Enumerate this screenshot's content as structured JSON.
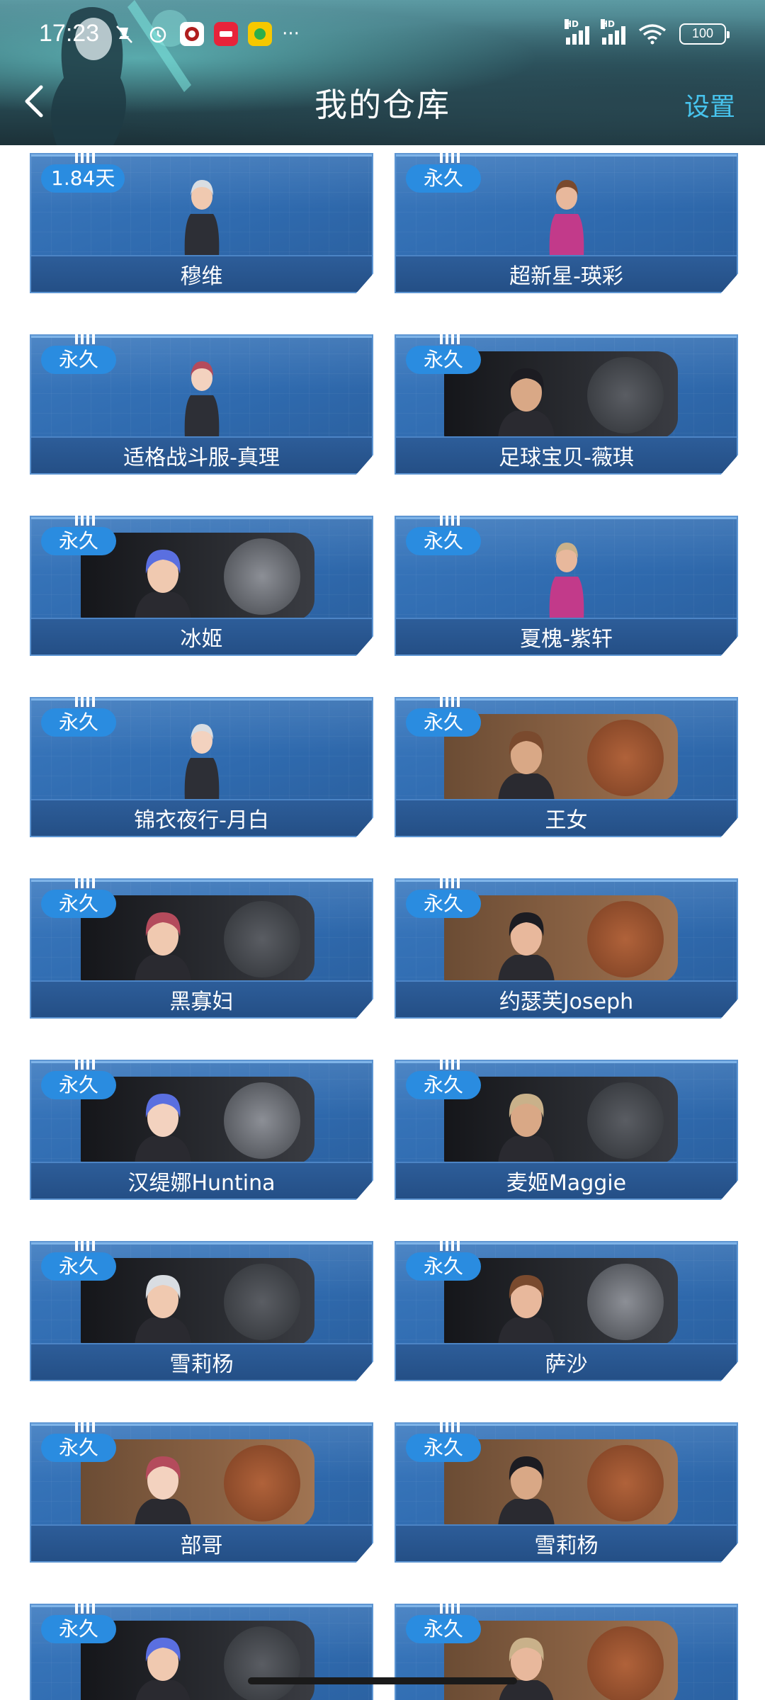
{
  "status_bar": {
    "time": "17:23",
    "battery": "100",
    "hd_label": "HD",
    "left_icons": [
      "silent-icon",
      "alarm-icon",
      "app-icon-1",
      "app-icon-2",
      "app-icon-3"
    ],
    "more": "···"
  },
  "header": {
    "title": "我的仓库",
    "settings": "设置"
  },
  "cards": [
    {
      "badge": "1.84天",
      "name": "穆维",
      "style": "figure"
    },
    {
      "badge": "永久",
      "name": "超新星-瑛彩",
      "style": "figure"
    },
    {
      "badge": "永久",
      "name": "适格战斗服-真理",
      "style": "figure"
    },
    {
      "badge": "永久",
      "name": "足球宝贝-薇琪",
      "style": "dark",
      "emblem": "sword"
    },
    {
      "badge": "永久",
      "name": "冰姬",
      "style": "dark",
      "emblem": "star"
    },
    {
      "badge": "永久",
      "name": "夏槐-紫轩",
      "style": "figure"
    },
    {
      "badge": "永久",
      "name": "锦衣夜行-月白",
      "style": "figure"
    },
    {
      "badge": "永久",
      "name": "王女",
      "style": "bronze",
      "emblem": "fist"
    },
    {
      "badge": "永久",
      "name": "黑寡妇",
      "style": "dark",
      "emblem": "sword"
    },
    {
      "badge": "永久",
      "name": "约瑟芙Joseph",
      "style": "bronze",
      "emblem": "fist"
    },
    {
      "badge": "永久",
      "name": "汉缇娜Huntina",
      "style": "dark",
      "emblem": "star"
    },
    {
      "badge": "永久",
      "name": "麦姬Maggie",
      "style": "dark",
      "emblem": "sword"
    },
    {
      "badge": "永久",
      "name": "雪莉杨",
      "style": "dark",
      "emblem": "sword"
    },
    {
      "badge": "永久",
      "name": "萨沙",
      "style": "dark",
      "emblem": "star"
    },
    {
      "badge": "永久",
      "name": "部哥",
      "style": "bronze",
      "emblem": "fist"
    },
    {
      "badge": "永久",
      "name": "雪莉杨",
      "style": "bronze",
      "emblem": "fist"
    },
    {
      "badge": "永久",
      "name": "",
      "style": "dark",
      "emblem": "sword"
    },
    {
      "badge": "永久",
      "name": "",
      "style": "bronze",
      "emblem": "fist"
    }
  ]
}
